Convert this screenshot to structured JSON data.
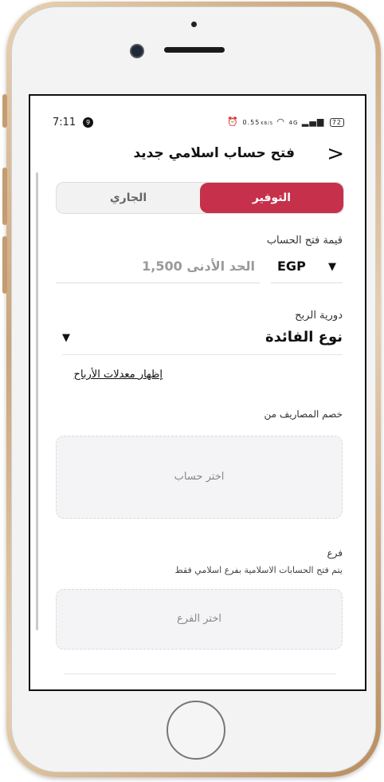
{
  "status_bar": {
    "time": "7:11",
    "notification_count": "9",
    "speed_value": "0.55",
    "speed_unit": "KB/S",
    "network": "4G",
    "battery": "72"
  },
  "header": {
    "title": "فتح حساب اسلامي جديد",
    "back_icon": "chevron-right-icon"
  },
  "account_type": {
    "options": [
      "التوفير",
      "الجاري"
    ],
    "selected": "التوفير",
    "accent_color": "#c6304a"
  },
  "opening_amount": {
    "label": "قيمة فتح الحساب",
    "currency": "EGP",
    "placeholder": "الحد الأدنى 1,500"
  },
  "profit_frequency": {
    "label": "دورية الربح",
    "value": "نوع الفائدة"
  },
  "show_rates_link": "إظهار معدلات الأرباح",
  "debit_account": {
    "label": "خصم المصاريف من",
    "placeholder": "اختر حساب"
  },
  "branch": {
    "label": "فرع",
    "note": "يتم فتح الحسابات الاسلامية بفرع اسلامي فقط",
    "placeholder": "اختر الفرع"
  }
}
